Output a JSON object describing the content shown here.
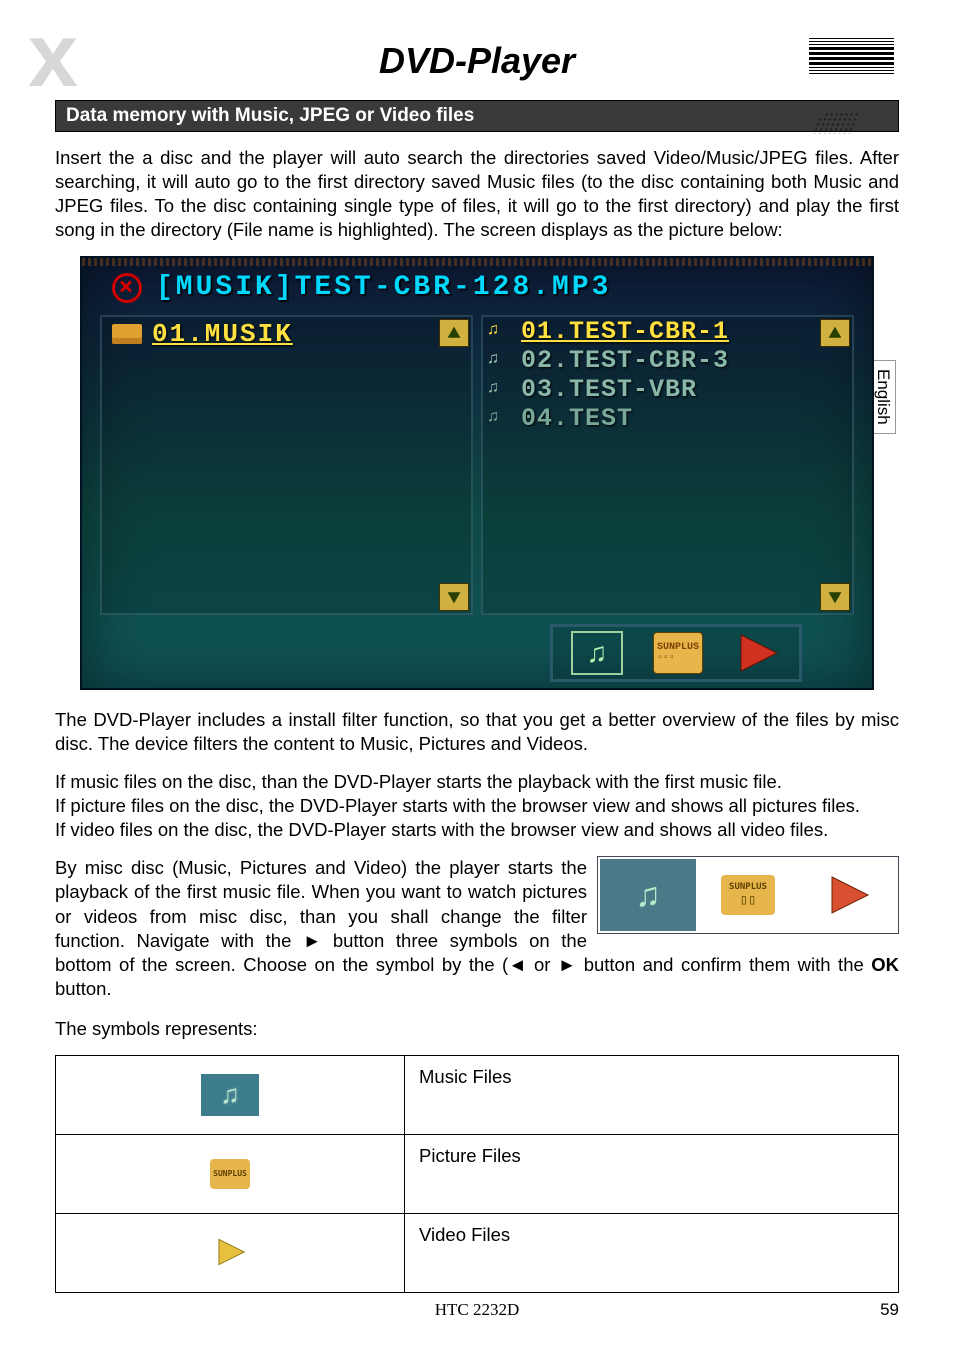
{
  "header": {
    "logo": "x",
    "title": "DVD-Player"
  },
  "side_tab": "English",
  "section_heading": "Data memory with Music, JPEG or Video files",
  "intro_paragraph": "Insert the a disc and the player will auto search the directories saved Video/Music/JPEG files. After searching, it will auto go to the first directory saved Music files (to the disc containing both Music and JPEG files. To the disc containing single type of files, it will go to the first directory) and play the first song in the directory (File name is highlighted). The screen displays as the picture below:",
  "screenshot": {
    "title": "[MUSIK]TEST-CBR-128.MP3",
    "folder": "01.MUSIK",
    "files": [
      "01.TEST-CBR-1",
      "02.TEST-CBR-3",
      "03.TEST-VBR",
      "04.TEST"
    ]
  },
  "paragraph2": "The DVD-Player includes a install filter function, so that you get a better overview of the files by misc disc. The device filters the content to Music, Pictures and Videos.",
  "paragraph2b": "If music files on the disc, than the DVD-Player starts the playback with the first music file.",
  "paragraph2c": "If picture files on the disc, the DVD-Player starts with the browser view and shows all pictures files.",
  "paragraph2d": "If video files on the disc, the DVD-Player starts with the browser view and shows all video files.",
  "paragraph3a": "By misc disc (Music, Pictures and Video) the player starts the playback of the first music file. When you want to watch pictures or videos from misc disc, than you shall change the filter function. Navigate with the ► button three symbols on the bottom of the screen. Choose on the symbol by the (◄ or ► button and confirm them with the ",
  "paragraph3b": "OK",
  "paragraph3c": " button.",
  "represents_label": "The symbols represents:",
  "table": {
    "row1": "Music Files",
    "row2": "Picture Files",
    "row3": "Video Files"
  },
  "footer": {
    "model": "HTC 2232D",
    "page": "59"
  }
}
